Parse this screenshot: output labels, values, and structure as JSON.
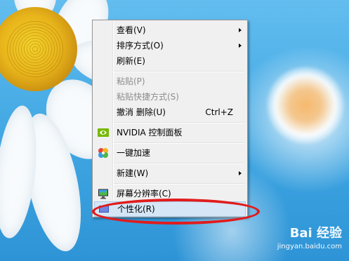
{
  "menu": {
    "items": [
      {
        "label": "查看(V)"
      },
      {
        "label": "排序方式(O)"
      },
      {
        "label": "刷新(E)"
      },
      {
        "label": "粘贴(P)"
      },
      {
        "label": "粘贴快捷方式(S)"
      },
      {
        "label": "撤消 删除(U)",
        "shortcut": "Ctrl+Z"
      },
      {
        "label": "NVIDIA 控制面板"
      },
      {
        "label": "一键加速"
      },
      {
        "label": "新建(W)"
      },
      {
        "label": "屏幕分辨率(C)"
      },
      {
        "label": "个性化(R)"
      }
    ]
  },
  "icons": {
    "nvidia": "nvidia-icon",
    "speedup": "speedup-icon",
    "display": "monitor-icon",
    "personalize": "personalize-icon"
  },
  "colors": {
    "annotation": "#e11c1c",
    "highlight": "#d5e6f6",
    "desktop": "#4aa9e3"
  },
  "watermark": {
    "logo": "Bai 经验",
    "url": "jingyan.baidu.com"
  }
}
